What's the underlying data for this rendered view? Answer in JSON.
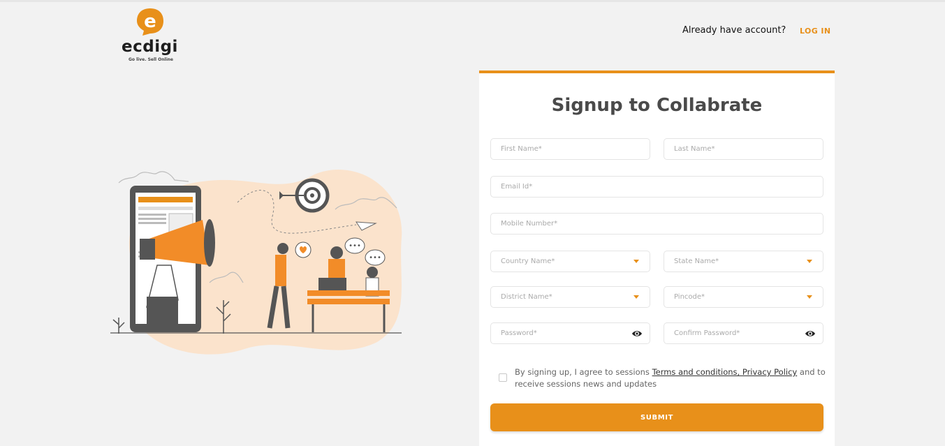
{
  "brand": {
    "name": "ecdigi",
    "tagline": "Go live. Sell Online",
    "accent": "#e8901a"
  },
  "header": {
    "already_text": "Already have account?",
    "login_label": "LOG IN"
  },
  "form": {
    "title": "Signup to Collabrate",
    "first_name": "First Name*",
    "last_name": "Last Name*",
    "email": "Email Id*",
    "mobile": "Mobile Number*",
    "country": "Country Name*",
    "state": "State Name*",
    "district": "District Name*",
    "pincode": "Pincode*",
    "password": "Password*",
    "confirm_password": "Confirm Password*",
    "agree_prefix": "By signing up, I agree to sessions",
    "terms_link": "Terms and conditions, Privacy Policy",
    "agree_suffix": "and to receive sessions news and updates",
    "submit_label": "SUBMIT"
  }
}
